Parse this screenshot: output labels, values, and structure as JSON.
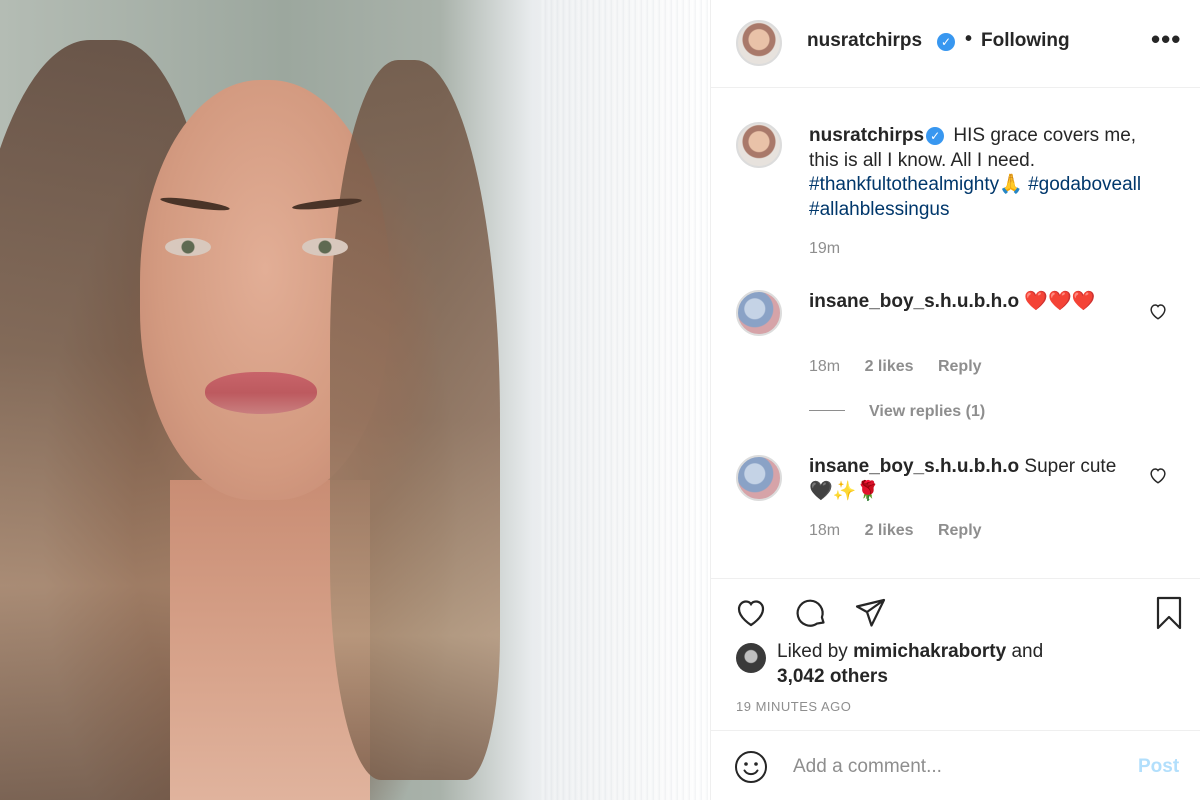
{
  "post": {
    "username": "nusratchirps",
    "follow_dot": "•",
    "follow_label": "Following",
    "more_label": "•••",
    "caption_text": "HIS grace covers me, this is all I know. All I need.",
    "hashtag_1": "#thankfultothealmighty🙏",
    "hashtag_2": "#godaboveall",
    "hashtag_3": "#allahblessingus",
    "caption_time": "19m"
  },
  "comments": [
    {
      "username": "insane_boy_s.h.u.b.h.o",
      "text": "❤️❤️❤️",
      "time": "18m",
      "likes": "2 likes",
      "reply": "Reply"
    },
    {
      "username": "insane_boy_s.h.u.b.h.o",
      "text": "Super cute 🖤✨🌹",
      "time": "18m",
      "likes": "2 likes",
      "reply": "Reply"
    }
  ],
  "view_replies": "View replies (1)",
  "likes": {
    "prefix": "Liked by",
    "user": "mimichakraborty",
    "and": "and",
    "others": "3,042 others"
  },
  "posted_ago": "19 MINUTES AGO",
  "add_comment": {
    "placeholder": "Add a comment...",
    "post_label": "Post"
  },
  "colors": {
    "verified_blue": "#3897f0",
    "hashtag": "#00376b",
    "muted": "#8e8e8e",
    "post_disabled": "#b2dffc"
  }
}
